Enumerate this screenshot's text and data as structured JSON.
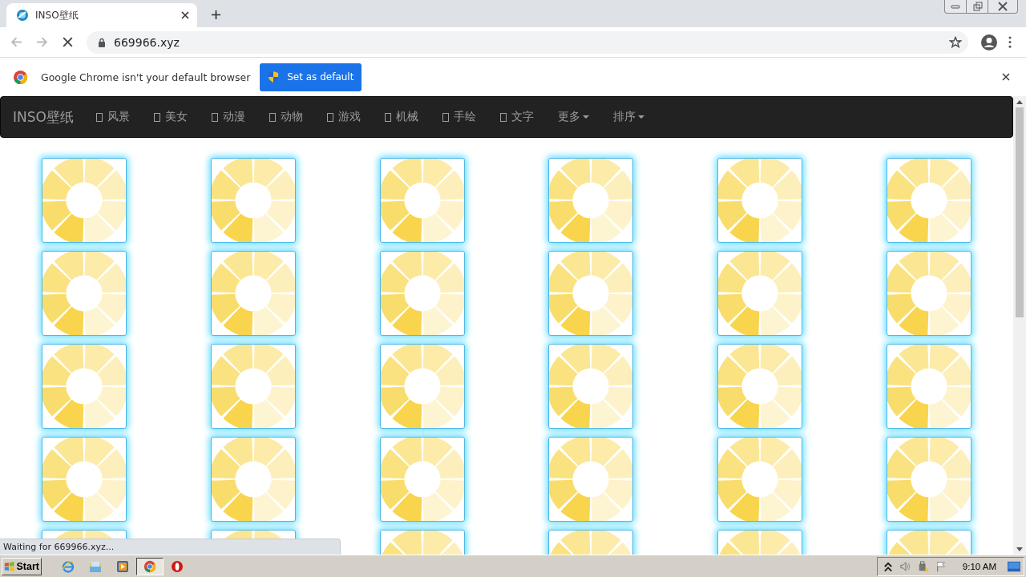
{
  "browser": {
    "tab": {
      "title": "INSO壁纸"
    },
    "address": "669966.xyz",
    "loading": true
  },
  "infobar": {
    "message": "Google Chrome isn't your default browser",
    "button": "Set as default"
  },
  "navbar": {
    "brand": "INSO壁纸",
    "items": [
      {
        "label": "风景",
        "kind": "link"
      },
      {
        "label": "美女",
        "kind": "link"
      },
      {
        "label": "动漫",
        "kind": "link"
      },
      {
        "label": "动物",
        "kind": "link"
      },
      {
        "label": "游戏",
        "kind": "link"
      },
      {
        "label": "机械",
        "kind": "link"
      },
      {
        "label": "手绘",
        "kind": "link"
      },
      {
        "label": "文字",
        "kind": "link"
      },
      {
        "label": "更多",
        "kind": "dropdown"
      },
      {
        "label": "排序",
        "kind": "dropdown"
      }
    ]
  },
  "thumbnails": [
    {
      "kind": "spinner"
    },
    {
      "kind": "spinner"
    },
    {
      "kind": "spinner"
    },
    {
      "kind": "spinner"
    },
    {
      "kind": "spinner"
    },
    {
      "kind": "spinner"
    },
    {
      "kind": "spinner"
    },
    {
      "kind": "spinner"
    },
    {
      "kind": "spinner"
    },
    {
      "kind": "spinner"
    },
    {
      "kind": "spinner"
    },
    {
      "kind": "spinner"
    },
    {
      "kind": "spinner"
    },
    {
      "kind": "spinner"
    },
    {
      "kind": "spinner"
    },
    {
      "kind": "spinner"
    },
    {
      "kind": "spinner"
    },
    {
      "kind": "spinner"
    },
    {
      "kind": "spinner"
    },
    {
      "kind": "spinner"
    },
    {
      "kind": "spinner"
    },
    {
      "kind": "spinner"
    },
    {
      "kind": "spinner"
    },
    {
      "kind": "spinner"
    },
    {
      "kind": "spinner"
    },
    {
      "kind": "spinner"
    },
    {
      "kind": "spinner"
    },
    {
      "kind": "spinner"
    },
    {
      "kind": "spinner"
    },
    {
      "kind": "spinner"
    }
  ],
  "status_bubble": "Waiting for 669966.xyz...",
  "taskbar": {
    "start": "Start",
    "apps": [
      {
        "kind": "ie",
        "selected": false
      },
      {
        "kind": "explorer",
        "selected": false
      },
      {
        "kind": "media",
        "selected": false
      },
      {
        "kind": "chrome",
        "selected": true
      },
      {
        "kind": "opera",
        "selected": false
      }
    ],
    "clock": "9:10 AM"
  }
}
